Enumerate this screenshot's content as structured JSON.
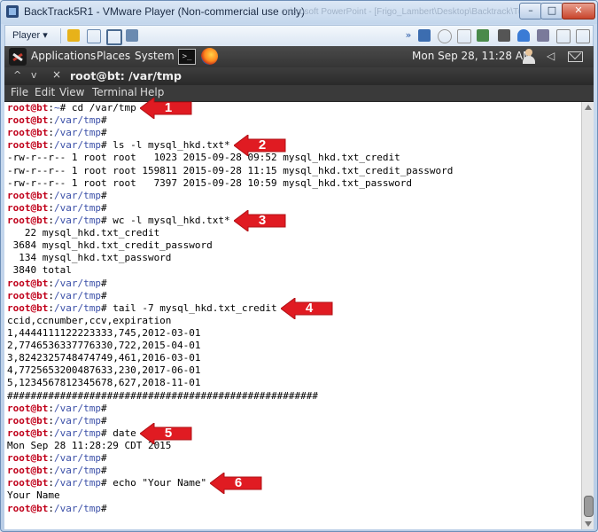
{
  "vm": {
    "title": "BackTrack5R1 - VMware Player (Non-commercial use only)",
    "ghost_title": "microsoft PowerPoint - [Frigo_Lambert\\Desktop\\Backtrack\\Tutorial...]",
    "player_menu": "Player ▾",
    "minimize_glyph": "–",
    "maximize_glyph": "□",
    "close_glyph": "✕"
  },
  "panel": {
    "applications": "Applications",
    "places": "Places",
    "system": "System",
    "terminal_launcher_glyph": ">_",
    "clock": "Mon Sep 28, 11:28 AM",
    "volume_glyph": "◁"
  },
  "terminal": {
    "title": "root@bt: /var/tmp",
    "controls": {
      "up": "^",
      "down": "v",
      "close": "×"
    },
    "menu": {
      "file": "File",
      "edit": "Edit",
      "view": "View",
      "terminal": "Terminal",
      "help": "Help"
    },
    "lines": [
      {
        "type": "prompt",
        "user": "root@bt",
        "path": "~",
        "cmd": "cd /var/tmp"
      },
      {
        "type": "prompt",
        "user": "root@bt",
        "path": "/var/tmp",
        "cmd": ""
      },
      {
        "type": "prompt",
        "user": "root@bt",
        "path": "/var/tmp",
        "cmd": ""
      },
      {
        "type": "prompt",
        "user": "root@bt",
        "path": "/var/tmp",
        "cmd": "ls -l mysql_hkd.txt*"
      },
      {
        "type": "out",
        "text": "-rw-r--r-- 1 root root   1023 2015-09-28 09:52 mysql_hkd.txt_credit"
      },
      {
        "type": "out",
        "text": "-rw-r--r-- 1 root root 159811 2015-09-28 11:15 mysql_hkd.txt_credit_password"
      },
      {
        "type": "out",
        "text": "-rw-r--r-- 1 root root   7397 2015-09-28 10:59 mysql_hkd.txt_password"
      },
      {
        "type": "prompt",
        "user": "root@bt",
        "path": "/var/tmp",
        "cmd": ""
      },
      {
        "type": "prompt",
        "user": "root@bt",
        "path": "/var/tmp",
        "cmd": ""
      },
      {
        "type": "prompt",
        "user": "root@bt",
        "path": "/var/tmp",
        "cmd": "wc -l mysql_hkd.txt*"
      },
      {
        "type": "out",
        "text": "   22 mysql_hkd.txt_credit"
      },
      {
        "type": "out",
        "text": " 3684 mysql_hkd.txt_credit_password"
      },
      {
        "type": "out",
        "text": "  134 mysql_hkd.txt_password"
      },
      {
        "type": "out",
        "text": " 3840 total"
      },
      {
        "type": "prompt",
        "user": "root@bt",
        "path": "/var/tmp",
        "cmd": ""
      },
      {
        "type": "prompt",
        "user": "root@bt",
        "path": "/var/tmp",
        "cmd": ""
      },
      {
        "type": "prompt",
        "user": "root@bt",
        "path": "/var/tmp",
        "cmd": "tail -7 mysql_hkd.txt_credit"
      },
      {
        "type": "out",
        "text": "ccid,ccnumber,ccv,expiration"
      },
      {
        "type": "out",
        "text": "1,4444111122223333,745,2012-03-01"
      },
      {
        "type": "out",
        "text": "2,7746536337776330,722,2015-04-01"
      },
      {
        "type": "out",
        "text": "3,8242325748474749,461,2016-03-01"
      },
      {
        "type": "out",
        "text": "4,7725653200487633,230,2017-06-01"
      },
      {
        "type": "out",
        "text": "5,1234567812345678,627,2018-11-01"
      },
      {
        "type": "out",
        "text": "#####################################################"
      },
      {
        "type": "prompt",
        "user": "root@bt",
        "path": "/var/tmp",
        "cmd": ""
      },
      {
        "type": "prompt",
        "user": "root@bt",
        "path": "/var/tmp",
        "cmd": ""
      },
      {
        "type": "prompt",
        "user": "root@bt",
        "path": "/var/tmp",
        "cmd": "date"
      },
      {
        "type": "out",
        "text": "Mon Sep 28 11:28:29 CDT 2015"
      },
      {
        "type": "prompt",
        "user": "root@bt",
        "path": "/var/tmp",
        "cmd": ""
      },
      {
        "type": "prompt",
        "user": "root@bt",
        "path": "/var/tmp",
        "cmd": ""
      },
      {
        "type": "prompt",
        "user": "root@bt",
        "path": "/var/tmp",
        "cmd": "echo \"Your Name\""
      },
      {
        "type": "out",
        "text": "Your Name"
      },
      {
        "type": "prompt",
        "user": "root@bt",
        "path": "/var/tmp",
        "cmd": ""
      }
    ]
  },
  "annotations": [
    {
      "label": "1",
      "line": 0
    },
    {
      "label": "2",
      "line": 3
    },
    {
      "label": "3",
      "line": 9
    },
    {
      "label": "4",
      "line": 16
    },
    {
      "label": "5",
      "line": 26
    },
    {
      "label": "6",
      "line": 30
    }
  ],
  "colors": {
    "arrow": "#e01b22",
    "prompt_user": "#c0001a",
    "prompt_path": "#3a4fa8"
  }
}
